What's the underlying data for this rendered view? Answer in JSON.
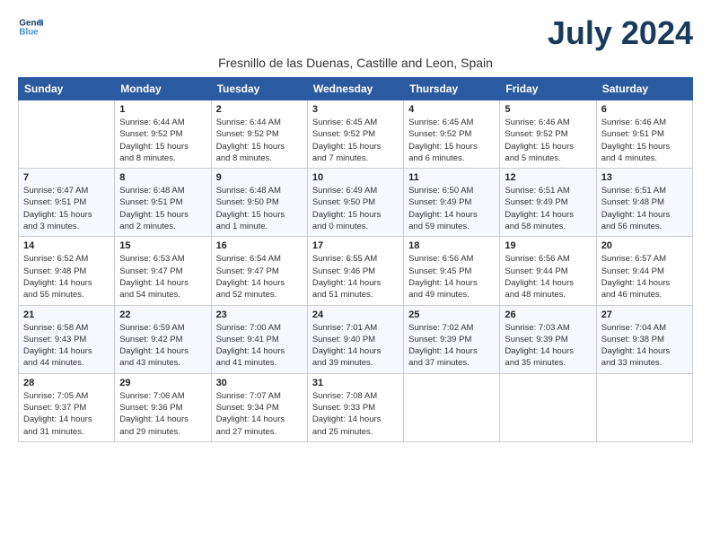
{
  "logo": {
    "line1": "General",
    "line2": "Blue"
  },
  "title": "July 2024",
  "subtitle": "Fresnillo de las Duenas, Castille and Leon, Spain",
  "days_of_week": [
    "Sunday",
    "Monday",
    "Tuesday",
    "Wednesday",
    "Thursday",
    "Friday",
    "Saturday"
  ],
  "weeks": [
    [
      {
        "day": "",
        "info": ""
      },
      {
        "day": "1",
        "info": "Sunrise: 6:44 AM\nSunset: 9:52 PM\nDaylight: 15 hours\nand 8 minutes."
      },
      {
        "day": "2",
        "info": "Sunrise: 6:44 AM\nSunset: 9:52 PM\nDaylight: 15 hours\nand 8 minutes."
      },
      {
        "day": "3",
        "info": "Sunrise: 6:45 AM\nSunset: 9:52 PM\nDaylight: 15 hours\nand 7 minutes."
      },
      {
        "day": "4",
        "info": "Sunrise: 6:45 AM\nSunset: 9:52 PM\nDaylight: 15 hours\nand 6 minutes."
      },
      {
        "day": "5",
        "info": "Sunrise: 6:46 AM\nSunset: 9:52 PM\nDaylight: 15 hours\nand 5 minutes."
      },
      {
        "day": "6",
        "info": "Sunrise: 6:46 AM\nSunset: 9:51 PM\nDaylight: 15 hours\nand 4 minutes."
      }
    ],
    [
      {
        "day": "7",
        "info": "Sunrise: 6:47 AM\nSunset: 9:51 PM\nDaylight: 15 hours\nand 3 minutes."
      },
      {
        "day": "8",
        "info": "Sunrise: 6:48 AM\nSunset: 9:51 PM\nDaylight: 15 hours\nand 2 minutes."
      },
      {
        "day": "9",
        "info": "Sunrise: 6:48 AM\nSunset: 9:50 PM\nDaylight: 15 hours\nand 1 minute."
      },
      {
        "day": "10",
        "info": "Sunrise: 6:49 AM\nSunset: 9:50 PM\nDaylight: 15 hours\nand 0 minutes."
      },
      {
        "day": "11",
        "info": "Sunrise: 6:50 AM\nSunset: 9:49 PM\nDaylight: 14 hours\nand 59 minutes."
      },
      {
        "day": "12",
        "info": "Sunrise: 6:51 AM\nSunset: 9:49 PM\nDaylight: 14 hours\nand 58 minutes."
      },
      {
        "day": "13",
        "info": "Sunrise: 6:51 AM\nSunset: 9:48 PM\nDaylight: 14 hours\nand 56 minutes."
      }
    ],
    [
      {
        "day": "14",
        "info": "Sunrise: 6:52 AM\nSunset: 9:48 PM\nDaylight: 14 hours\nand 55 minutes."
      },
      {
        "day": "15",
        "info": "Sunrise: 6:53 AM\nSunset: 9:47 PM\nDaylight: 14 hours\nand 54 minutes."
      },
      {
        "day": "16",
        "info": "Sunrise: 6:54 AM\nSunset: 9:47 PM\nDaylight: 14 hours\nand 52 minutes."
      },
      {
        "day": "17",
        "info": "Sunrise: 6:55 AM\nSunset: 9:46 PM\nDaylight: 14 hours\nand 51 minutes."
      },
      {
        "day": "18",
        "info": "Sunrise: 6:56 AM\nSunset: 9:45 PM\nDaylight: 14 hours\nand 49 minutes."
      },
      {
        "day": "19",
        "info": "Sunrise: 6:56 AM\nSunset: 9:44 PM\nDaylight: 14 hours\nand 48 minutes."
      },
      {
        "day": "20",
        "info": "Sunrise: 6:57 AM\nSunset: 9:44 PM\nDaylight: 14 hours\nand 46 minutes."
      }
    ],
    [
      {
        "day": "21",
        "info": "Sunrise: 6:58 AM\nSunset: 9:43 PM\nDaylight: 14 hours\nand 44 minutes."
      },
      {
        "day": "22",
        "info": "Sunrise: 6:59 AM\nSunset: 9:42 PM\nDaylight: 14 hours\nand 43 minutes."
      },
      {
        "day": "23",
        "info": "Sunrise: 7:00 AM\nSunset: 9:41 PM\nDaylight: 14 hours\nand 41 minutes."
      },
      {
        "day": "24",
        "info": "Sunrise: 7:01 AM\nSunset: 9:40 PM\nDaylight: 14 hours\nand 39 minutes."
      },
      {
        "day": "25",
        "info": "Sunrise: 7:02 AM\nSunset: 9:39 PM\nDaylight: 14 hours\nand 37 minutes."
      },
      {
        "day": "26",
        "info": "Sunrise: 7:03 AM\nSunset: 9:39 PM\nDaylight: 14 hours\nand 35 minutes."
      },
      {
        "day": "27",
        "info": "Sunrise: 7:04 AM\nSunset: 9:38 PM\nDaylight: 14 hours\nand 33 minutes."
      }
    ],
    [
      {
        "day": "28",
        "info": "Sunrise: 7:05 AM\nSunset: 9:37 PM\nDaylight: 14 hours\nand 31 minutes."
      },
      {
        "day": "29",
        "info": "Sunrise: 7:06 AM\nSunset: 9:36 PM\nDaylight: 14 hours\nand 29 minutes."
      },
      {
        "day": "30",
        "info": "Sunrise: 7:07 AM\nSunset: 9:34 PM\nDaylight: 14 hours\nand 27 minutes."
      },
      {
        "day": "31",
        "info": "Sunrise: 7:08 AM\nSunset: 9:33 PM\nDaylight: 14 hours\nand 25 minutes."
      },
      {
        "day": "",
        "info": ""
      },
      {
        "day": "",
        "info": ""
      },
      {
        "day": "",
        "info": ""
      }
    ]
  ]
}
